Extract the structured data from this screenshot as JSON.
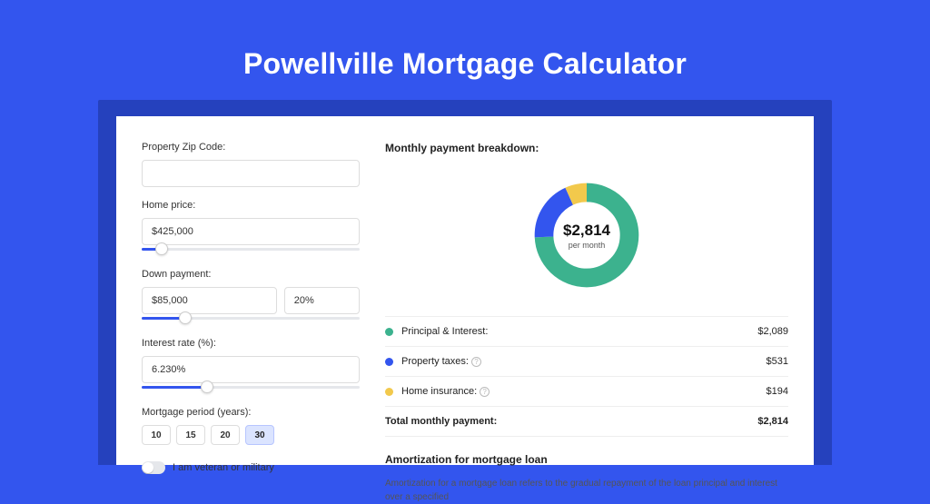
{
  "page_title": "Powellville Mortgage Calculator",
  "form": {
    "zip_label": "Property Zip Code:",
    "zip_value": "",
    "home_price_label": "Home price:",
    "home_price_value": "$425,000",
    "down_payment_label": "Down payment:",
    "down_payment_amount": "$85,000",
    "down_payment_percent": "20%",
    "interest_label": "Interest rate (%):",
    "interest_value": "6.230%",
    "period_label": "Mortgage period (years):",
    "periods": [
      "10",
      "15",
      "20",
      "30"
    ],
    "period_selected": "30",
    "veteran_label": "I am veteran or military"
  },
  "breakdown": {
    "title": "Monthly payment breakdown:",
    "center_value": "$2,814",
    "center_sub": "per month",
    "items": [
      {
        "label": "Principal & Interest:",
        "value": "$2,089",
        "color": "#3cb28e",
        "info": false
      },
      {
        "label": "Property taxes:",
        "value": "$531",
        "color": "#3355ee",
        "info": true
      },
      {
        "label": "Home insurance:",
        "value": "$194",
        "color": "#f2c94c",
        "info": true
      }
    ],
    "total_label": "Total monthly payment:",
    "total_value": "$2,814"
  },
  "amort": {
    "title": "Amortization for mortgage loan",
    "text": "Amortization for a mortgage loan refers to the gradual repayment of the loan principal and interest over a specified"
  },
  "chart_data": {
    "type": "pie",
    "title": "Monthly payment breakdown",
    "series": [
      {
        "name": "Principal & Interest",
        "value": 2089,
        "color": "#3cb28e"
      },
      {
        "name": "Property taxes",
        "value": 531,
        "color": "#3355ee"
      },
      {
        "name": "Home insurance",
        "value": 194,
        "color": "#f2c94c"
      }
    ],
    "total": 2814,
    "center_label": "$2,814 per month"
  },
  "sliders": {
    "home_price_pct": 9,
    "down_payment_pct": 20,
    "interest_pct": 30
  }
}
